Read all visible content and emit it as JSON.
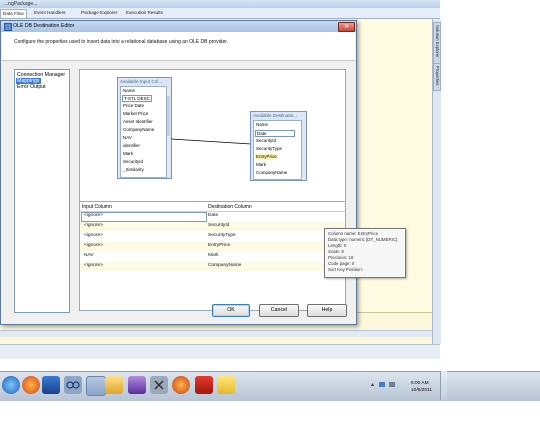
{
  "ide": {
    "window_title": "...ngPackage...",
    "tabs": [
      "Data Flow",
      "Event Handlers",
      "Package Explorer",
      "Execution Results"
    ],
    "side_tabs": [
      "Solution Explorer",
      "Properties"
    ]
  },
  "dialog": {
    "title": "OLE DB Destination Editor",
    "close_glyph": "✕",
    "description": "Configure the properties used to insert data into a relational database using an OLE DB provider.",
    "nav_items": [
      "Connection Manager",
      "Mappings",
      "Error Output"
    ],
    "selected_nav": 1,
    "input_table": {
      "title": "Available Input Col...",
      "rows": [
        "Name",
        "T-STL DESC",
        "Price Date",
        "Market Price",
        "Asset Identifier",
        "CompanyName",
        "NAV",
        "identifier",
        "Mark",
        "SecurityId",
        "_Similarity"
      ]
    },
    "dest_table": {
      "title": "Available Destinatio...",
      "rows": [
        "Name",
        "Date",
        "SecurityId",
        "SecurityType",
        "EntryPrice",
        "Mark",
        "CompanyName"
      ]
    },
    "grid": {
      "headers": [
        "Input Column",
        "Destination Column"
      ],
      "rows": [
        [
          "<ignore>",
          "Date"
        ],
        [
          "<ignore>",
          "SecurityId"
        ],
        [
          "<ignore>",
          "SecurityType"
        ],
        [
          "<ignore>",
          "EntryPrice"
        ],
        [
          "NAV",
          "Mark"
        ],
        [
          "<ignore>",
          "CompanyName"
        ]
      ]
    },
    "tooltip": [
      "Column name: EntryPrice",
      "Data type: numeric [DT_NUMERIC]",
      "Length: 0",
      "Scale: 8",
      "Precision: 18",
      "Code page: 0",
      "Sort Key Position:"
    ],
    "buttons": {
      "ok": "OK",
      "cancel": "Cancel",
      "help": "Help"
    }
  },
  "taskbar": {
    "icons": [
      "start-orb",
      "firefox",
      "explorer",
      "link",
      "media",
      "folder",
      "visual-studio",
      "tools",
      "firefox-alt",
      "acrobat",
      "notes"
    ],
    "time": "6:00 AM",
    "date": "10/5/2011"
  }
}
